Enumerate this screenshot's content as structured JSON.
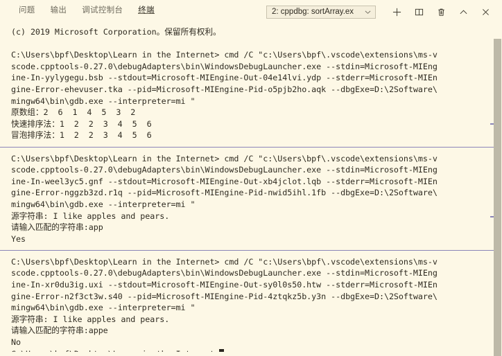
{
  "panel": {
    "tabs": [
      {
        "label": "问题",
        "active": false
      },
      {
        "label": "输出",
        "active": false
      },
      {
        "label": "调试控制台",
        "active": false
      },
      {
        "label": "终端",
        "active": true
      }
    ],
    "terminal_select": {
      "value": "2: cppdbg: sortArray.ex",
      "caret_icon": "chevron-down-icon"
    },
    "actions": [
      {
        "name": "new-terminal-button",
        "icon": "plus-icon",
        "title": "新建终端"
      },
      {
        "name": "split-terminal-button",
        "icon": "split-panel-icon",
        "title": "拆分终端"
      },
      {
        "name": "kill-terminal-button",
        "icon": "trash-icon",
        "title": "终止终端"
      },
      {
        "name": "maximize-panel-button",
        "icon": "chevron-up-icon",
        "title": "最大化面板大小"
      },
      {
        "name": "close-panel-button",
        "icon": "close-icon",
        "title": "关闭面板"
      }
    ]
  },
  "colors": {
    "background": "#fdf8e6",
    "foreground": "#2e2a20",
    "separator": "#8a84b8",
    "scrollbar_thumb": "#bdb9a8",
    "select_border": "#c8c2ae",
    "tab_active": "#2f2b22",
    "tab_inactive": "#6f6b5e"
  },
  "terminal_lines": [
    {
      "type": "text",
      "text": "(c) 2019 Microsoft Corporation。保留所有权利。"
    },
    {
      "type": "blank",
      "text": " "
    },
    {
      "type": "text",
      "text": "C:\\Users\\bpf\\Desktop\\Learn in the Internet> cmd /C \"c:\\Users\\bpf\\.vscode\\extensions\\ms-v"
    },
    {
      "type": "text",
      "text": "scode.cpptools-0.27.0\\debugAdapters\\bin\\WindowsDebugLauncher.exe --stdin=Microsoft-MIEng"
    },
    {
      "type": "text",
      "text": "ine-In-yylygegu.bsb --stdout=Microsoft-MIEngine-Out-04e14lvi.ydp --stderr=Microsoft-MIEn"
    },
    {
      "type": "text",
      "text": "gine-Error-ehevuser.tka --pid=Microsoft-MIEngine-Pid-o5pjb2ho.aqk --dbgExe=D:\\2Software\\"
    },
    {
      "type": "text",
      "text": "mingw64\\bin\\gdb.exe --interpreter=mi \""
    },
    {
      "type": "text",
      "text": "原数组：2  6  1  4  5  3  2"
    },
    {
      "type": "text",
      "text": "快速排序法：1  2  2  3  4  5  6"
    },
    {
      "type": "text",
      "text": "冒泡排序法：1  2  2  3  4  5  6"
    },
    {
      "type": "separator",
      "text": " "
    },
    {
      "type": "text",
      "text": "C:\\Users\\bpf\\Desktop\\Learn in the Internet> cmd /C \"c:\\Users\\bpf\\.vscode\\extensions\\ms-v"
    },
    {
      "type": "text",
      "text": "scode.cpptools-0.27.0\\debugAdapters\\bin\\WindowsDebugLauncher.exe --stdin=Microsoft-MIEng"
    },
    {
      "type": "text",
      "text": "ine-In-weel3yc5.gnf --stdout=Microsoft-MIEngine-Out-xb4jclot.lqb --stderr=Microsoft-MIEn"
    },
    {
      "type": "text",
      "text": "gine-Error-nggzb3zd.r1q --pid=Microsoft-MIEngine-Pid-nwid5ihl.1fb --dbgExe=D:\\2Software\\"
    },
    {
      "type": "text",
      "text": "mingw64\\bin\\gdb.exe --interpreter=mi \""
    },
    {
      "type": "text",
      "text": "源字符串: I like apples and pears."
    },
    {
      "type": "text",
      "text": "请输入匹配的字符串:app"
    },
    {
      "type": "text",
      "text": "Yes"
    },
    {
      "type": "separator",
      "text": " "
    },
    {
      "type": "text",
      "text": "C:\\Users\\bpf\\Desktop\\Learn in the Internet> cmd /C \"c:\\Users\\bpf\\.vscode\\extensions\\ms-v"
    },
    {
      "type": "text",
      "text": "scode.cpptools-0.27.0\\debugAdapters\\bin\\WindowsDebugLauncher.exe --stdin=Microsoft-MIEng"
    },
    {
      "type": "text",
      "text": "ine-In-xr0du3ig.uxi --stdout=Microsoft-MIEngine-Out-sy0l0s50.htw --stderr=Microsoft-MIEn"
    },
    {
      "type": "text",
      "text": "gine-Error-n2f3ct3w.s40 --pid=Microsoft-MIEngine-Pid-4ztqkz5b.y3n --dbgExe=D:\\2Software\\"
    },
    {
      "type": "text",
      "text": "mingw64\\bin\\gdb.exe --interpreter=mi \""
    },
    {
      "type": "text",
      "text": "源字符串: I like apples and pears."
    },
    {
      "type": "text",
      "text": "请输入匹配的字符串:appe"
    },
    {
      "type": "text",
      "text": "No"
    },
    {
      "type": "prompt",
      "text": "C:\\Users\\bpf\\Desktop\\Learn in the Internet>"
    }
  ]
}
